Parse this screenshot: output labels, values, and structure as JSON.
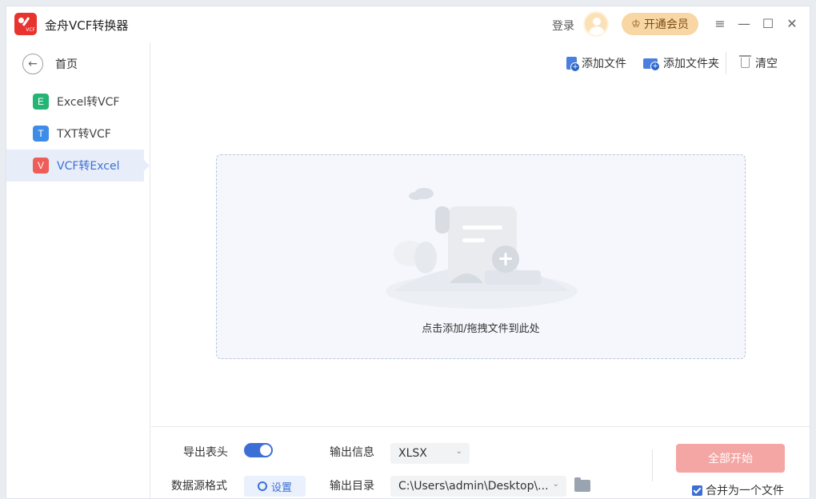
{
  "app": {
    "title": "金舟VCF转换器",
    "logo_tag": "VCF"
  },
  "header": {
    "login_label": "登录",
    "vip_label": "开通会员",
    "vip_icon": "crown-icon",
    "controls": [
      "≡",
      "—",
      "☐",
      "✕"
    ]
  },
  "sidebar": {
    "home_label": "首页",
    "items": [
      {
        "badge": "E",
        "label": "Excel转VCF",
        "color": "#22b573"
      },
      {
        "badge": "T",
        "label": "TXT转VCF",
        "color": "#3d8de8"
      },
      {
        "badge": "V",
        "label": "VCF转Excel",
        "color": "#ee5d57",
        "active": true
      }
    ]
  },
  "toolbar": {
    "add_file": "添加文件",
    "add_folder": "添加文件夹",
    "clear": "清空"
  },
  "dropzone": {
    "label": "点击添加/拖拽文件到此处"
  },
  "settings": {
    "export_header_label": "导出表头",
    "export_header_on": true,
    "source_format_label": "数据源格式",
    "settings_button": "设置",
    "output_info_label": "输出信息",
    "output_format": "XLSX",
    "output_dir_label": "输出目录",
    "output_dir": "C:\\Users\\admin\\Desktop\\...",
    "start_button": "全部开始",
    "merge_label": "合并为一个文件",
    "merge_checked": true
  }
}
